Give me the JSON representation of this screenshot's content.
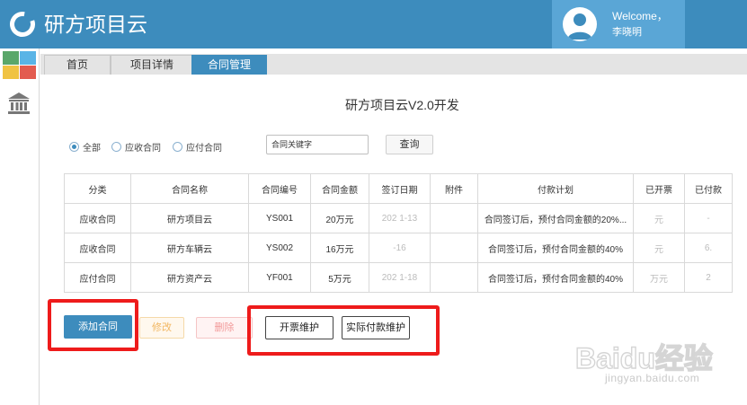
{
  "header": {
    "app_title": "研方项目云",
    "welcome": "Welcome，",
    "username": "李晓明",
    "colors": {
      "header_bg": "#3d8cbd",
      "user_bg": "#5aa6d6"
    },
    "icons": {
      "logo": "ring-logo-icon",
      "avatar": "user-avatar-icon"
    }
  },
  "sidebar": {
    "tile_colors": [
      "#5aa76a",
      "#5ab4e6",
      "#f0c343",
      "#e35b4f"
    ],
    "icons": [
      "color-grid-icon",
      "bank-icon"
    ]
  },
  "tabs": [
    {
      "label": "首页",
      "active": false
    },
    {
      "label": "项目详情",
      "active": false
    },
    {
      "label": "合同管理",
      "active": true
    }
  ],
  "page": {
    "heading": "研方项目云V2.0开发"
  },
  "filters": {
    "radios": [
      {
        "label": "全部",
        "checked": true
      },
      {
        "label": "应收合同",
        "checked": false
      },
      {
        "label": "应付合同",
        "checked": false
      }
    ],
    "search_placeholder": "合同关键字",
    "query_label": "查询"
  },
  "table": {
    "columns": [
      "分类",
      "合同名称",
      "合同编号",
      "合同金额",
      "签订日期",
      "附件",
      "付款计划",
      "已开票",
      "已付款"
    ],
    "rows": [
      [
        "应收合同",
        "研方项目云",
        "YS001",
        "20万元",
        "202 1-13",
        "",
        "合同签订后，预付合同金额的20%...",
        "元",
        "-"
      ],
      [
        "应收合同",
        "研方车辆云",
        "YS002",
        "16万元",
        "-16",
        "",
        "合同签订后，预付合同金额的40%",
        "元",
        "6."
      ],
      [
        "应付合同",
        "研方资产云",
        "YF001",
        "5万元",
        "202 1-18",
        "",
        "合同签订后，预付合同金额的40%",
        "万元",
        "2"
      ]
    ]
  },
  "actions": {
    "add": "添加合同",
    "edit": "修改",
    "delete": "删除",
    "invoice": "开票维护",
    "payment": "实际付款维护"
  },
  "highlight_color": "#ee1b1b",
  "watermark": {
    "brand": "Baidu经验",
    "url": "jingyan.baidu.com"
  }
}
